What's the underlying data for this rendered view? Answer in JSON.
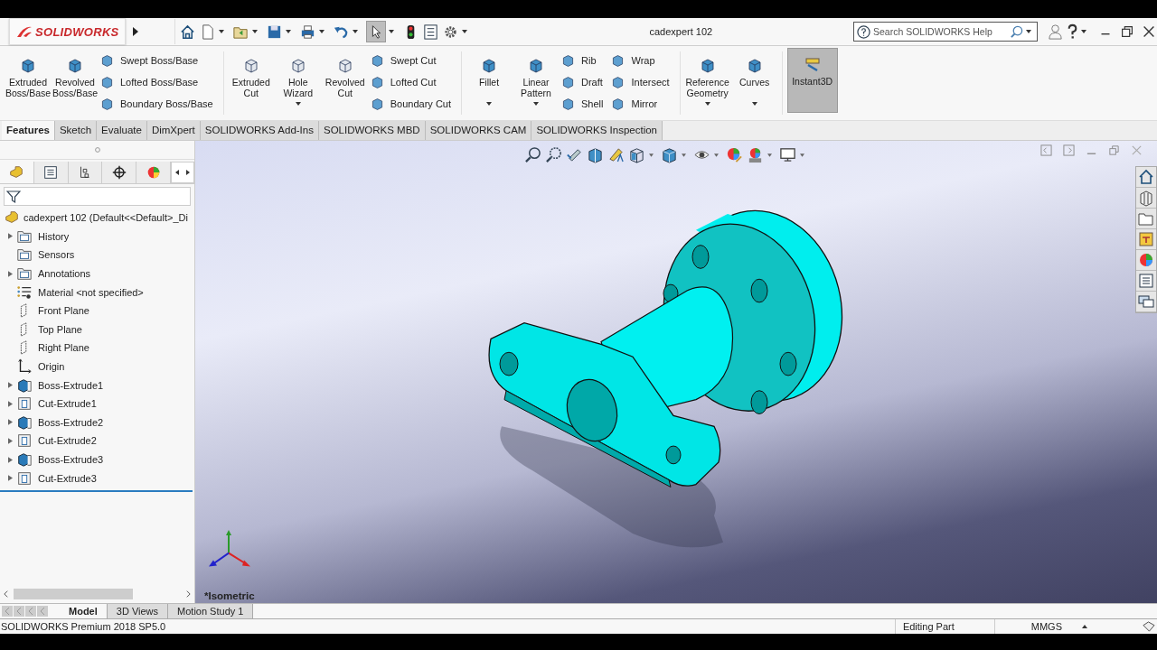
{
  "title_bar": {
    "app_name": "SOLIDWORKS",
    "document_title": "cadexpert 102",
    "search": {
      "placeholder": "Search SOLIDWORKS Help"
    }
  },
  "ribbon": {
    "groups": [
      {
        "large": [
          {
            "label": "Extruded Boss/Base",
            "dropdown": false
          },
          {
            "label": "Revolved Boss/Base",
            "dropdown": false
          }
        ],
        "small": [
          "Swept Boss/Base",
          "Lofted Boss/Base",
          "Boundary Boss/Base"
        ]
      },
      {
        "large": [
          {
            "label": "Extruded Cut",
            "dropdown": false
          },
          {
            "label": "Hole Wizard",
            "dropdown": true
          },
          {
            "label": "Revolved Cut",
            "dropdown": false
          }
        ],
        "small": [
          "Swept Cut",
          "Lofted Cut",
          "Boundary Cut"
        ]
      },
      {
        "large": [
          {
            "label": "Fillet",
            "dropdown": true
          },
          {
            "label": "Linear Pattern",
            "dropdown": true
          }
        ],
        "small": [
          "Rib",
          "Draft",
          "Shell"
        ],
        "small2": [
          "Wrap",
          "Intersect",
          "Mirror"
        ]
      },
      {
        "large": [
          {
            "label": "Reference Geometry",
            "dropdown": true
          },
          {
            "label": "Curves",
            "dropdown": true
          }
        ]
      }
    ],
    "instant3d": {
      "label": "Instant3D",
      "on": true
    }
  },
  "command_tabs": [
    {
      "label": "Features",
      "selected": true
    },
    {
      "label": "Sketch",
      "selected": false
    },
    {
      "label": "Evaluate",
      "selected": false
    },
    {
      "label": "DimXpert",
      "selected": false
    },
    {
      "label": "SOLIDWORKS Add-Ins",
      "selected": false
    },
    {
      "label": "SOLIDWORKS MBD",
      "selected": false
    },
    {
      "label": "SOLIDWORKS CAM",
      "selected": false
    },
    {
      "label": "SOLIDWORKS Inspection",
      "selected": false
    }
  ],
  "feature_tree": {
    "root": "cadexpert 102  (Default<<Default>_Di",
    "items": [
      {
        "label": "History",
        "kind": "folder",
        "expandable": true
      },
      {
        "label": "Sensors",
        "kind": "folder",
        "expandable": false
      },
      {
        "label": "Annotations",
        "kind": "folder",
        "expandable": true
      },
      {
        "label": "Material <not specified>",
        "kind": "material",
        "expandable": false
      },
      {
        "label": "Front Plane",
        "kind": "plane",
        "expandable": false
      },
      {
        "label": "Top Plane",
        "kind": "plane",
        "expandable": false
      },
      {
        "label": "Right Plane",
        "kind": "plane",
        "expandable": false
      },
      {
        "label": "Origin",
        "kind": "origin",
        "expandable": false
      },
      {
        "label": "Boss-Extrude1",
        "kind": "boss",
        "expandable": true
      },
      {
        "label": "Cut-Extrude1",
        "kind": "cut",
        "expandable": true
      },
      {
        "label": "Boss-Extrude2",
        "kind": "boss",
        "expandable": true
      },
      {
        "label": "Cut-Extrude2",
        "kind": "cut",
        "expandable": true
      },
      {
        "label": "Boss-Extrude3",
        "kind": "boss",
        "expandable": true
      },
      {
        "label": "Cut-Extrude3",
        "kind": "cut",
        "expandable": true
      }
    ]
  },
  "viewport": {
    "view_name": "*Isometric"
  },
  "bottom_tabs": [
    {
      "label": "Model",
      "selected": true
    },
    {
      "label": "3D Views",
      "selected": false
    },
    {
      "label": "Motion Study 1",
      "selected": false
    }
  ],
  "status_bar": {
    "product": "SOLIDWORKS Premium 2018 SP5.0",
    "mode": "Editing Part",
    "units": "MMGS"
  }
}
